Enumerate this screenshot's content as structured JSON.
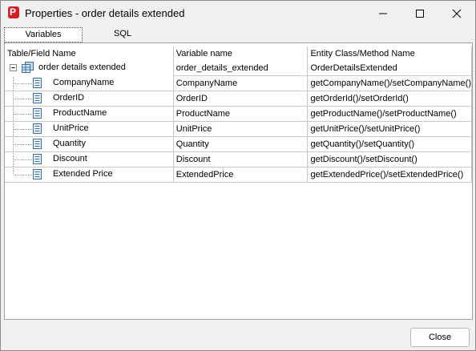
{
  "window": {
    "title": "Properties - order details extended",
    "app_icon_letter": "P"
  },
  "tabs": [
    {
      "label": "Variables",
      "active": true
    },
    {
      "label": "SQL",
      "active": false
    }
  ],
  "table": {
    "headers": [
      "Table/Field Name",
      "Variable name",
      "Entity Class/Method Name"
    ],
    "root": {
      "name": "order details extended",
      "variable": "order_details_extended",
      "entity": "OrderDetailsExtended",
      "expanded": true
    },
    "fields": [
      {
        "name": "CompanyName",
        "variable": "CompanyName",
        "method": "getCompanyName()/setCompanyName()"
      },
      {
        "name": "OrderID",
        "variable": "OrderID",
        "method": "getOrderId()/setOrderId()"
      },
      {
        "name": "ProductName",
        "variable": "ProductName",
        "method": "getProductName()/setProductName()"
      },
      {
        "name": "UnitPrice",
        "variable": "UnitPrice",
        "method": "getUnitPrice()/setUnitPrice()"
      },
      {
        "name": "Quantity",
        "variable": "Quantity",
        "method": "getQuantity()/setQuantity()"
      },
      {
        "name": "Discount",
        "variable": "Discount",
        "method": "getDiscount()/setDiscount()"
      },
      {
        "name": "Extended Price",
        "variable": "ExtendedPrice",
        "method": "getExtendedPrice()/setExtendedPrice()"
      }
    ]
  },
  "footer": {
    "close_label": "Close"
  },
  "icons": {
    "app": "app-logo-icon",
    "minimize": "minimize-icon",
    "maximize": "maximize-icon",
    "close": "close-icon",
    "table": "table-icon",
    "field": "field-icon",
    "collapse": "collapse-icon"
  }
}
